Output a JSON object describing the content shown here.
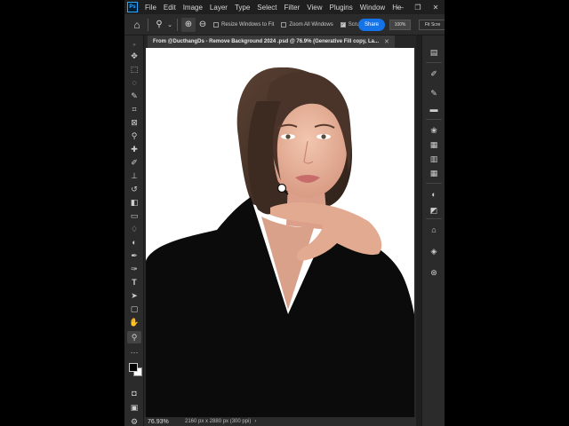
{
  "app": {
    "logo": "Ps",
    "menu": [
      "File",
      "Edit",
      "Image",
      "Layer",
      "Type",
      "Select",
      "Filter",
      "View",
      "Plugins",
      "Window",
      "He"
    ],
    "window_controls": [
      "—",
      "❐",
      "✕"
    ]
  },
  "options": {
    "home_icon": "home-icon",
    "zoom_tool_icon": "zoom-tool-icon",
    "zoom_in_icon": "zoom-in-icon",
    "zoom_out_icon": "zoom-out-icon",
    "resize_windows": {
      "label": "Resize Windows to Fit",
      "checked": false
    },
    "zoom_all": {
      "label": "Zoom All Windows",
      "checked": false
    },
    "scrubby": {
      "label": "Scru",
      "checked": true
    },
    "share_label": "Share",
    "zoom_percent": "100%",
    "fit_label": "Fit Scre"
  },
  "document": {
    "tab_title": "From @DucthangDs - Remove Background 2024 .psd @ 76.9% (Generative Fill copy, La...",
    "zoom_status": "76.93%",
    "dimensions": "2160 px x 2880 px (300 ppi)",
    "status_arrow": "›"
  },
  "tools": [
    {
      "name": "move-tool-icon",
      "glyph": "✥"
    },
    {
      "name": "marquee-tool-icon",
      "glyph": "⬚"
    },
    {
      "name": "lasso-tool-icon",
      "glyph": "◌"
    },
    {
      "name": "object-select-tool-icon",
      "glyph": "✎"
    },
    {
      "name": "crop-tool-icon",
      "glyph": "⌗"
    },
    {
      "name": "frame-tool-icon",
      "glyph": "⊠"
    },
    {
      "name": "eyedropper-tool-icon",
      "glyph": "⚲"
    },
    {
      "name": "healing-brush-tool-icon",
      "glyph": "✚"
    },
    {
      "name": "brush-tool-icon",
      "glyph": "✐"
    },
    {
      "name": "stamp-tool-icon",
      "glyph": "⊥"
    },
    {
      "name": "history-brush-tool-icon",
      "glyph": "↺"
    },
    {
      "name": "eraser-tool-icon",
      "glyph": "◧"
    },
    {
      "name": "gradient-tool-icon",
      "glyph": "▭"
    },
    {
      "name": "blur-tool-icon",
      "glyph": "💧"
    },
    {
      "name": "dodge-tool-icon",
      "glyph": "◐"
    },
    {
      "name": "pen-tool-icon",
      "glyph": "✒"
    },
    {
      "name": "type-tool-icon",
      "glyph": "T"
    },
    {
      "name": "path-select-tool-icon",
      "glyph": "➤"
    },
    {
      "name": "rectangle-tool-icon",
      "glyph": "▢"
    },
    {
      "name": "hand-tool-icon",
      "glyph": "✋"
    },
    {
      "name": "zoom-tool-icon",
      "glyph": "⚲"
    },
    {
      "name": "more-tools-icon",
      "glyph": "···"
    }
  ],
  "panels": [
    {
      "name": "libraries-panel-icon",
      "glyph": "▤"
    },
    {
      "name": "brush-settings-panel-icon",
      "glyph": "✐"
    },
    {
      "name": "adjustments-brush-panel-icon",
      "glyph": "✎"
    },
    {
      "name": "comments-panel-icon",
      "glyph": "▬"
    },
    {
      "name": "color-panel-icon",
      "glyph": "❀"
    },
    {
      "name": "swatches-panel-icon",
      "glyph": "▦"
    },
    {
      "name": "patterns-panel-icon",
      "glyph": "▦"
    },
    {
      "name": "adjustments-panel-icon",
      "glyph": "◐"
    },
    {
      "name": "properties-panel-icon",
      "glyph": "◩"
    },
    {
      "name": "paths-panel-icon",
      "glyph": "⌂"
    },
    {
      "name": "layers-panel-icon",
      "glyph": "◈"
    },
    {
      "name": "channels-panel-icon",
      "glyph": "⊛"
    }
  ],
  "colors": {
    "accent": "#1473e6",
    "foreground_swatch": "#000000",
    "background_swatch": "#ffffff"
  }
}
